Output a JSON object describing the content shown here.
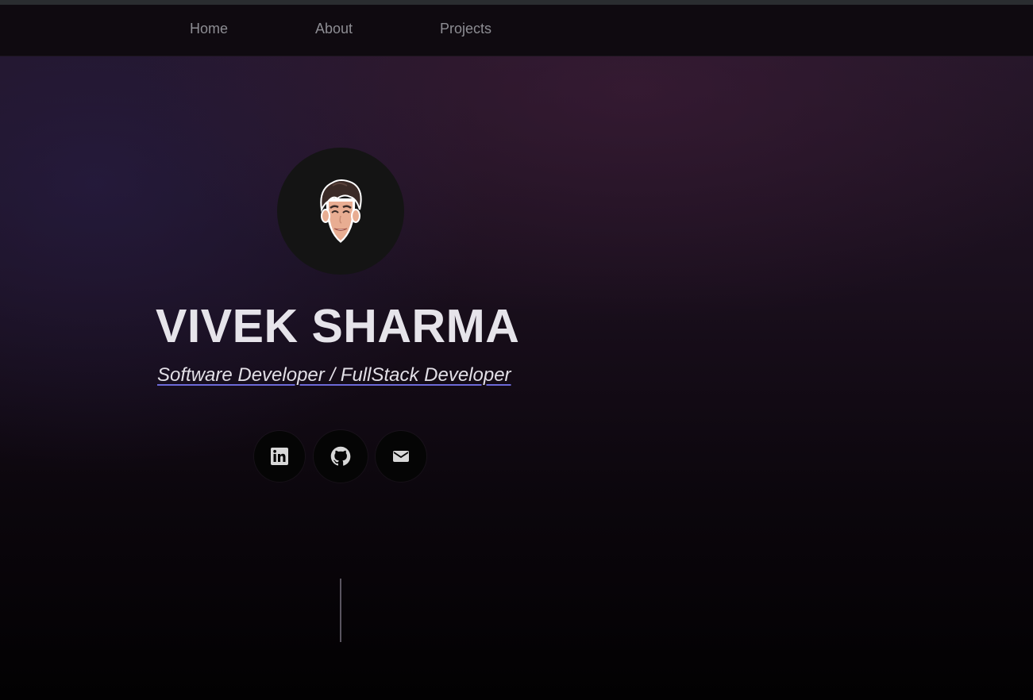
{
  "nav": {
    "links": [
      {
        "label": "Home"
      },
      {
        "label": "About"
      },
      {
        "label": "Projects"
      }
    ]
  },
  "hero": {
    "name": "VIVEK SHARMA",
    "tagline": "Software Developer / FullStack Developer",
    "avatar_icon": "cartoon-face-avatar",
    "social": [
      {
        "icon": "linkedin-icon"
      },
      {
        "icon": "github-icon"
      },
      {
        "icon": "mail-icon"
      }
    ]
  },
  "colors": {
    "nav_bg": "#0f0a10",
    "nav_text": "#8d8d93",
    "heading": "#e6e4ea",
    "underline_accent": "#6c6ad8",
    "avatar_bg": "#141414"
  }
}
